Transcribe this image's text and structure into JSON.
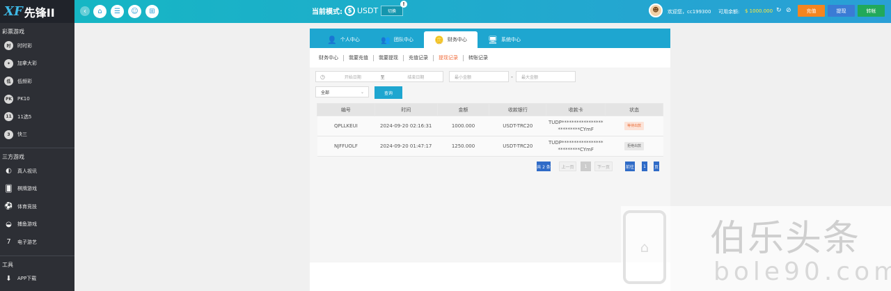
{
  "logo": {
    "mark": "XF",
    "text": "先锋II"
  },
  "sidebar": {
    "sections": [
      {
        "title": "彩票游戏",
        "items": [
          {
            "label": "时时彩",
            "icon": "时"
          },
          {
            "label": "加拿大彩",
            "icon": "leaf-icon"
          },
          {
            "label": "低频彩",
            "icon": "低"
          },
          {
            "label": "PK10",
            "icon": "PK"
          },
          {
            "label": "11选5",
            "icon": "11"
          },
          {
            "label": "快三",
            "icon": "3"
          }
        ]
      },
      {
        "title": "三方游戏",
        "items": [
          {
            "label": "真人视讯",
            "icon": "live-icon"
          },
          {
            "label": "棋牌游戏",
            "icon": "cards-icon"
          },
          {
            "label": "体育竞技",
            "icon": "ball-icon"
          },
          {
            "label": "捕鱼游戏",
            "icon": "fish-icon"
          },
          {
            "label": "电子游艺",
            "icon": "slot-icon"
          }
        ]
      },
      {
        "title": "工具",
        "items": [
          {
            "label": "APP下载",
            "icon": "download-icon"
          }
        ]
      }
    ]
  },
  "topbar": {
    "mode_label": "当前模式:",
    "mode_value": "USDT",
    "switch_label": "切换",
    "switch_badge": "!",
    "welcome": "欢迎您，cc199300",
    "balance_label": "可用余额:",
    "balance_value": "$ 1000.000",
    "deposit_label": "充值",
    "withdraw_label": "提现",
    "transfer_label": "转帐",
    "deposit_color": "#f5851f",
    "withdraw_color": "#3a7bd5",
    "transfer_color": "#21a95a"
  },
  "tabs": [
    {
      "label": "个人中心",
      "icon": "user-icon",
      "active": false
    },
    {
      "label": "团队中心",
      "icon": "team-icon",
      "active": false
    },
    {
      "label": "财务中心",
      "icon": "coins-icon",
      "active": true
    },
    {
      "label": "系统中心",
      "icon": "system-icon",
      "active": false
    }
  ],
  "subnav": [
    {
      "label": "财务中心",
      "active": false
    },
    {
      "label": "我要充值",
      "active": false
    },
    {
      "label": "我要提现",
      "active": false
    },
    {
      "label": "充值记录",
      "active": false
    },
    {
      "label": "提现记录",
      "active": true
    },
    {
      "label": "转账记录",
      "active": false
    }
  ],
  "filter": {
    "start_date_placeholder": "开始日期",
    "date_separator": "至",
    "end_date_placeholder": "结束日期",
    "min_amount_placeholder": "最小金额",
    "range_dash": "-",
    "max_amount_placeholder": "最大金额",
    "status_selected": "全部",
    "query_label": "查询"
  },
  "table": {
    "headers": [
      "编号",
      "时间",
      "金额",
      "收款银行",
      "收款卡",
      "状态"
    ],
    "rows": [
      {
        "id": "QPLLKEUI",
        "time": "2024-09-20 02:16:31",
        "amount": "1000.000",
        "bank": "USDT-TRC20",
        "card_line1": "TUDP*****************",
        "card_line2": "*********CYmF",
        "status": "等待出款",
        "status_type": "pending"
      },
      {
        "id": "NJFFUOLF",
        "time": "2024-09-20 01:47:17",
        "amount": "1250.000",
        "bank": "USDT-TRC20",
        "card_line1": "TUDP*****************",
        "card_line2": "*********CYmF",
        "status": "拒绝出款",
        "status_type": "rejected"
      }
    ]
  },
  "pager": {
    "total": "共 2 条",
    "prev": "上一页",
    "current": "1",
    "next": "下一页",
    "go_label": "前往",
    "page_num": "1",
    "page_suffix": "页"
  },
  "watermark": {
    "cn": "伯乐头条",
    "en": "bole90.com"
  }
}
